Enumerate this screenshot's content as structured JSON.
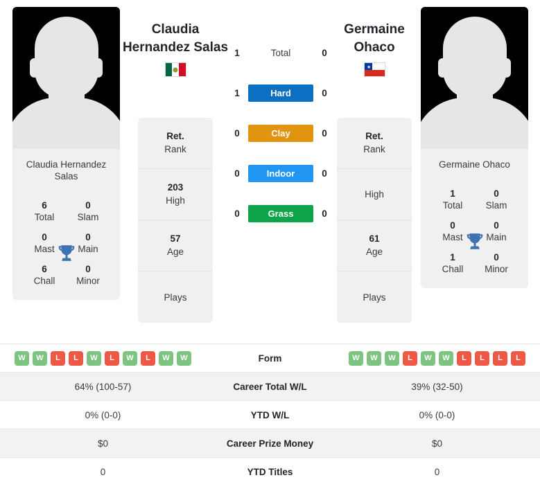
{
  "players": {
    "left": {
      "first_name": "Claudia",
      "last_name": "Hernandez Salas",
      "card_name": "Claudia Hernandez Salas",
      "country": "Mexico",
      "flag": "mexico-flag",
      "titles": {
        "total_val": "6",
        "total_lbl": "Total",
        "slam_val": "0",
        "slam_lbl": "Slam",
        "mast_val": "0",
        "mast_lbl": "Mast",
        "main_val": "0",
        "main_lbl": "Main",
        "chall_val": "6",
        "chall_lbl": "Chall",
        "minor_val": "0",
        "minor_lbl": "Minor"
      },
      "rank": [
        {
          "value": "Ret.",
          "label": "Rank"
        },
        {
          "value": "203",
          "label": "High"
        },
        {
          "value": "57",
          "label": "Age"
        },
        {
          "value": "",
          "label": "Plays"
        }
      ],
      "form": [
        "W",
        "W",
        "L",
        "L",
        "W",
        "L",
        "W",
        "L",
        "W",
        "W"
      ]
    },
    "right": {
      "first_name": "Germaine",
      "last_name": "Ohaco",
      "card_name": "Germaine Ohaco",
      "country": "Chile",
      "flag": "chile-flag",
      "titles": {
        "total_val": "1",
        "total_lbl": "Total",
        "slam_val": "0",
        "slam_lbl": "Slam",
        "mast_val": "0",
        "mast_lbl": "Mast",
        "main_val": "0",
        "main_lbl": "Main",
        "chall_val": "1",
        "chall_lbl": "Chall",
        "minor_val": "0",
        "minor_lbl": "Minor"
      },
      "rank": [
        {
          "value": "Ret.",
          "label": "Rank"
        },
        {
          "value": "",
          "label": "High"
        },
        {
          "value": "61",
          "label": "Age"
        },
        {
          "value": "",
          "label": "Plays"
        }
      ],
      "form": [
        "W",
        "W",
        "W",
        "L",
        "W",
        "W",
        "L",
        "L",
        "L",
        "L"
      ]
    }
  },
  "head_to_head": [
    {
      "left": "1",
      "surface": "Total",
      "right": "0",
      "color": "transparent",
      "plain": true
    },
    {
      "left": "1",
      "surface": "Hard",
      "right": "0",
      "color": "#0c70c2",
      "plain": false
    },
    {
      "left": "0",
      "surface": "Clay",
      "right": "0",
      "color": "#e09410",
      "plain": false
    },
    {
      "left": "0",
      "surface": "Indoor",
      "right": "0",
      "color": "#2196f3",
      "plain": false
    },
    {
      "left": "0",
      "surface": "Grass",
      "right": "0",
      "color": "#0ea44a",
      "plain": false
    }
  ],
  "comparison_rows": [
    {
      "label": "Form",
      "left": "",
      "right": "",
      "is_form": true,
      "shade": false
    },
    {
      "label": "Career Total W/L",
      "left": "64% (100-57)",
      "right": "39% (32-50)",
      "is_form": false,
      "shade": true
    },
    {
      "label": "YTD W/L",
      "left": "0% (0-0)",
      "right": "0% (0-0)",
      "is_form": false,
      "shade": false
    },
    {
      "label": "Career Prize Money",
      "left": "$0",
      "right": "$0",
      "is_form": false,
      "shade": true
    },
    {
      "label": "YTD Titles",
      "left": "0",
      "right": "0",
      "is_form": false,
      "shade": false
    }
  ],
  "colors": {
    "win_badge": "#7cc47f",
    "loss_badge": "#ef5844",
    "card_bg": "#f0f0f0",
    "trophy": "#3f72b0"
  }
}
